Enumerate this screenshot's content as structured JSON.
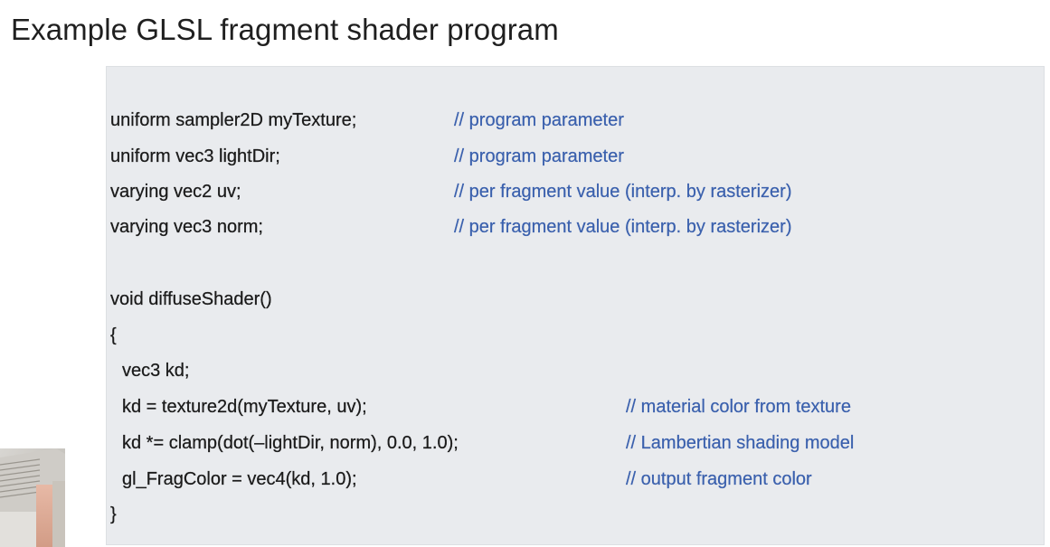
{
  "slide": {
    "title": "Example GLSL fragment shader program"
  },
  "code": {
    "lines": [
      {
        "text": "uniform sampler2D myTexture;",
        "comment": "// program parameter"
      },
      {
        "text": "uniform vec3 lightDir;",
        "comment": "// program parameter"
      },
      {
        "text": "varying vec2 uv;",
        "comment": "// per fragment value (interp. by rasterizer)"
      },
      {
        "text": "varying vec3 norm;",
        "comment": "// per fragment value (interp. by rasterizer)"
      },
      {
        "text": "void diffuseShader()",
        "comment": ""
      },
      {
        "text": "{",
        "comment": ""
      },
      {
        "text": "vec3 kd;",
        "comment": ""
      },
      {
        "text": "kd = texture2d(myTexture, uv);",
        "comment": "// material color from texture"
      },
      {
        "text": "kd *= clamp(dot(–lightDir, norm), 0.0, 1.0);",
        "comment": "// Lambertian shading model"
      },
      {
        "text": "gl_FragColor = vec4(kd, 1.0);",
        "comment": "// output fragment color"
      },
      {
        "text": "}",
        "comment": ""
      }
    ]
  },
  "colors": {
    "code_text": "#1b1b1b",
    "comment_text": "#3a60ad",
    "panel_background": "#e9ebee"
  }
}
